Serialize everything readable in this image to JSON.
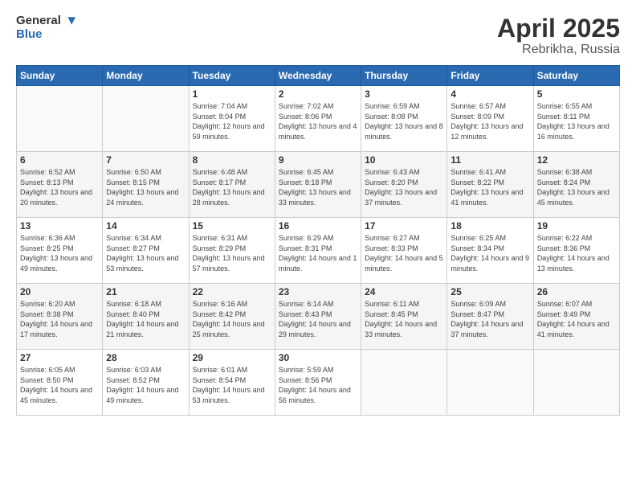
{
  "header": {
    "logo_general": "General",
    "logo_blue": "Blue",
    "month": "April 2025",
    "location": "Rebrikha, Russia"
  },
  "days_of_week": [
    "Sunday",
    "Monday",
    "Tuesday",
    "Wednesday",
    "Thursday",
    "Friday",
    "Saturday"
  ],
  "weeks": [
    [
      {
        "day": "",
        "info": ""
      },
      {
        "day": "",
        "info": ""
      },
      {
        "day": "1",
        "info": "Sunrise: 7:04 AM\nSunset: 8:04 PM\nDaylight: 12 hours and 59 minutes."
      },
      {
        "day": "2",
        "info": "Sunrise: 7:02 AM\nSunset: 8:06 PM\nDaylight: 13 hours and 4 minutes."
      },
      {
        "day": "3",
        "info": "Sunrise: 6:59 AM\nSunset: 8:08 PM\nDaylight: 13 hours and 8 minutes."
      },
      {
        "day": "4",
        "info": "Sunrise: 6:57 AM\nSunset: 8:09 PM\nDaylight: 13 hours and 12 minutes."
      },
      {
        "day": "5",
        "info": "Sunrise: 6:55 AM\nSunset: 8:11 PM\nDaylight: 13 hours and 16 minutes."
      }
    ],
    [
      {
        "day": "6",
        "info": "Sunrise: 6:52 AM\nSunset: 8:13 PM\nDaylight: 13 hours and 20 minutes."
      },
      {
        "day": "7",
        "info": "Sunrise: 6:50 AM\nSunset: 8:15 PM\nDaylight: 13 hours and 24 minutes."
      },
      {
        "day": "8",
        "info": "Sunrise: 6:48 AM\nSunset: 8:17 PM\nDaylight: 13 hours and 28 minutes."
      },
      {
        "day": "9",
        "info": "Sunrise: 6:45 AM\nSunset: 8:18 PM\nDaylight: 13 hours and 33 minutes."
      },
      {
        "day": "10",
        "info": "Sunrise: 6:43 AM\nSunset: 8:20 PM\nDaylight: 13 hours and 37 minutes."
      },
      {
        "day": "11",
        "info": "Sunrise: 6:41 AM\nSunset: 8:22 PM\nDaylight: 13 hours and 41 minutes."
      },
      {
        "day": "12",
        "info": "Sunrise: 6:38 AM\nSunset: 8:24 PM\nDaylight: 13 hours and 45 minutes."
      }
    ],
    [
      {
        "day": "13",
        "info": "Sunrise: 6:36 AM\nSunset: 8:25 PM\nDaylight: 13 hours and 49 minutes."
      },
      {
        "day": "14",
        "info": "Sunrise: 6:34 AM\nSunset: 8:27 PM\nDaylight: 13 hours and 53 minutes."
      },
      {
        "day": "15",
        "info": "Sunrise: 6:31 AM\nSunset: 8:29 PM\nDaylight: 13 hours and 57 minutes."
      },
      {
        "day": "16",
        "info": "Sunrise: 6:29 AM\nSunset: 8:31 PM\nDaylight: 14 hours and 1 minute."
      },
      {
        "day": "17",
        "info": "Sunrise: 6:27 AM\nSunset: 8:33 PM\nDaylight: 14 hours and 5 minutes."
      },
      {
        "day": "18",
        "info": "Sunrise: 6:25 AM\nSunset: 8:34 PM\nDaylight: 14 hours and 9 minutes."
      },
      {
        "day": "19",
        "info": "Sunrise: 6:22 AM\nSunset: 8:36 PM\nDaylight: 14 hours and 13 minutes."
      }
    ],
    [
      {
        "day": "20",
        "info": "Sunrise: 6:20 AM\nSunset: 8:38 PM\nDaylight: 14 hours and 17 minutes."
      },
      {
        "day": "21",
        "info": "Sunrise: 6:18 AM\nSunset: 8:40 PM\nDaylight: 14 hours and 21 minutes."
      },
      {
        "day": "22",
        "info": "Sunrise: 6:16 AM\nSunset: 8:42 PM\nDaylight: 14 hours and 25 minutes."
      },
      {
        "day": "23",
        "info": "Sunrise: 6:14 AM\nSunset: 8:43 PM\nDaylight: 14 hours and 29 minutes."
      },
      {
        "day": "24",
        "info": "Sunrise: 6:11 AM\nSunset: 8:45 PM\nDaylight: 14 hours and 33 minutes."
      },
      {
        "day": "25",
        "info": "Sunrise: 6:09 AM\nSunset: 8:47 PM\nDaylight: 14 hours and 37 minutes."
      },
      {
        "day": "26",
        "info": "Sunrise: 6:07 AM\nSunset: 8:49 PM\nDaylight: 14 hours and 41 minutes."
      }
    ],
    [
      {
        "day": "27",
        "info": "Sunrise: 6:05 AM\nSunset: 8:50 PM\nDaylight: 14 hours and 45 minutes."
      },
      {
        "day": "28",
        "info": "Sunrise: 6:03 AM\nSunset: 8:52 PM\nDaylight: 14 hours and 49 minutes."
      },
      {
        "day": "29",
        "info": "Sunrise: 6:01 AM\nSunset: 8:54 PM\nDaylight: 14 hours and 53 minutes."
      },
      {
        "day": "30",
        "info": "Sunrise: 5:59 AM\nSunset: 8:56 PM\nDaylight: 14 hours and 56 minutes."
      },
      {
        "day": "",
        "info": ""
      },
      {
        "day": "",
        "info": ""
      },
      {
        "day": "",
        "info": ""
      }
    ]
  ]
}
